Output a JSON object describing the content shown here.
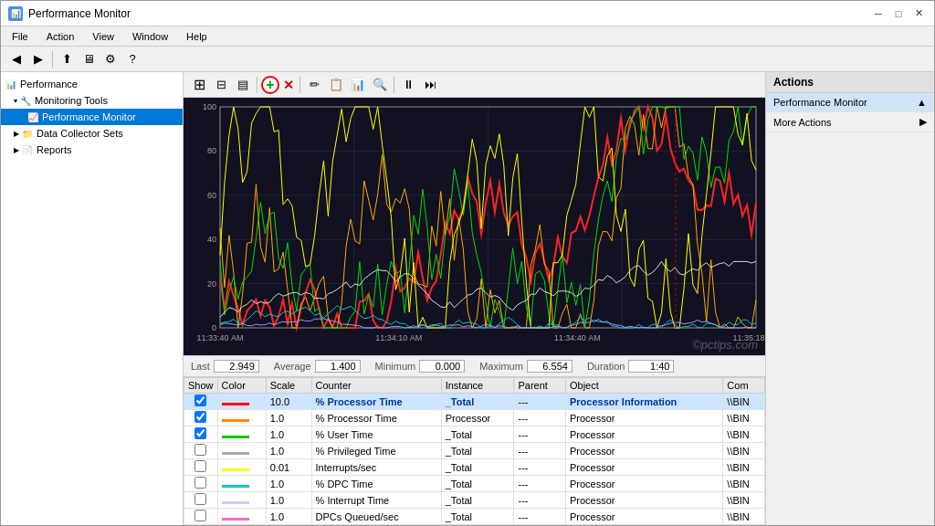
{
  "window": {
    "title": "Performance Monitor",
    "icon": "📊"
  },
  "menu": {
    "items": [
      "File",
      "Action",
      "View",
      "Window",
      "Help"
    ]
  },
  "sidebar": {
    "root_label": "Performance",
    "items": [
      {
        "id": "monitoring-tools",
        "label": "Monitoring Tools",
        "indent": 1,
        "expanded": true,
        "hasChevron": true
      },
      {
        "id": "performance-monitor",
        "label": "Performance Monitor",
        "indent": 2,
        "selected": true
      },
      {
        "id": "data-collector-sets",
        "label": "Data Collector Sets",
        "indent": 1,
        "hasChevron": true
      },
      {
        "id": "reports",
        "label": "Reports",
        "indent": 1,
        "hasChevron": true
      }
    ]
  },
  "graph": {
    "x_labels": [
      "11:33:40 AM",
      "11:34:10 AM",
      "11:34:40 AM",
      "11:35:18 AM"
    ],
    "y_labels": [
      "100",
      "80",
      "60",
      "40",
      "20",
      "0"
    ]
  },
  "stats": {
    "last_label": "Last",
    "last_value": "2.949",
    "avg_label": "Average",
    "avg_value": "1.400",
    "min_label": "Minimum",
    "min_value": "0.000",
    "max_label": "Maximum",
    "max_value": "6.554",
    "duration_label": "Duration",
    "duration_value": "1:40"
  },
  "table": {
    "headers": [
      "Show",
      "Color",
      "Scale",
      "Counter",
      "Instance",
      "Parent",
      "Object",
      "Com"
    ],
    "rows": [
      {
        "show": true,
        "color": "#ff0000",
        "scale": "10.0",
        "counter": "% Processor Time",
        "instance": "_Total",
        "parent": "---",
        "object": "Processor Information",
        "com": "\\\\BIN",
        "selected": true
      },
      {
        "show": true,
        "color": "#ff8800",
        "scale": "1.0",
        "counter": "% Processor Time",
        "instance": "Processor",
        "parent": "---",
        "object": "Processor",
        "com": "\\\\BIN",
        "selected": false
      },
      {
        "show": true,
        "color": "#00cc00",
        "scale": "1.0",
        "counter": "% User Time",
        "instance": "_Total",
        "parent": "---",
        "object": "Processor",
        "com": "\\\\BIN",
        "selected": false
      },
      {
        "show": false,
        "color": "#aaaaaa",
        "scale": "1.0",
        "counter": "% Privileged Time",
        "instance": "_Total",
        "parent": "---",
        "object": "Processor",
        "com": "\\\\BIN",
        "selected": false
      },
      {
        "show": false,
        "color": "#ffff00",
        "scale": "0.01",
        "counter": "Interrupts/sec",
        "instance": "_Total",
        "parent": "---",
        "object": "Processor",
        "com": "\\\\BIN",
        "selected": false
      },
      {
        "show": false,
        "color": "#00cccc",
        "scale": "1.0",
        "counter": "% DPC Time",
        "instance": "_Total",
        "parent": "---",
        "object": "Processor",
        "com": "\\\\BIN",
        "selected": false
      },
      {
        "show": false,
        "color": "#ccccff",
        "scale": "1.0",
        "counter": "% Interrupt Time",
        "instance": "_Total",
        "parent": "---",
        "object": "Processor",
        "com": "\\\\BIN",
        "selected": false
      },
      {
        "show": false,
        "color": "#ff66cc",
        "scale": "1.0",
        "counter": "DPCs Queued/sec",
        "instance": "_Total",
        "parent": "---",
        "object": "Processor",
        "com": "\\\\BIN",
        "selected": false
      }
    ]
  },
  "actions": {
    "title": "Actions",
    "items": [
      {
        "label": "Performance Monitor",
        "hasArrow": true
      },
      {
        "label": "More Actions",
        "hasArrow": true,
        "secondary": true
      }
    ]
  },
  "toolbar_graph": {
    "buttons": [
      "⊞",
      "⊟",
      "▤",
      "✚",
      "✖",
      "✏",
      "📋",
      "📊",
      "🔍",
      "⏸",
      "⏭"
    ]
  },
  "watermark": "©pctips.com"
}
